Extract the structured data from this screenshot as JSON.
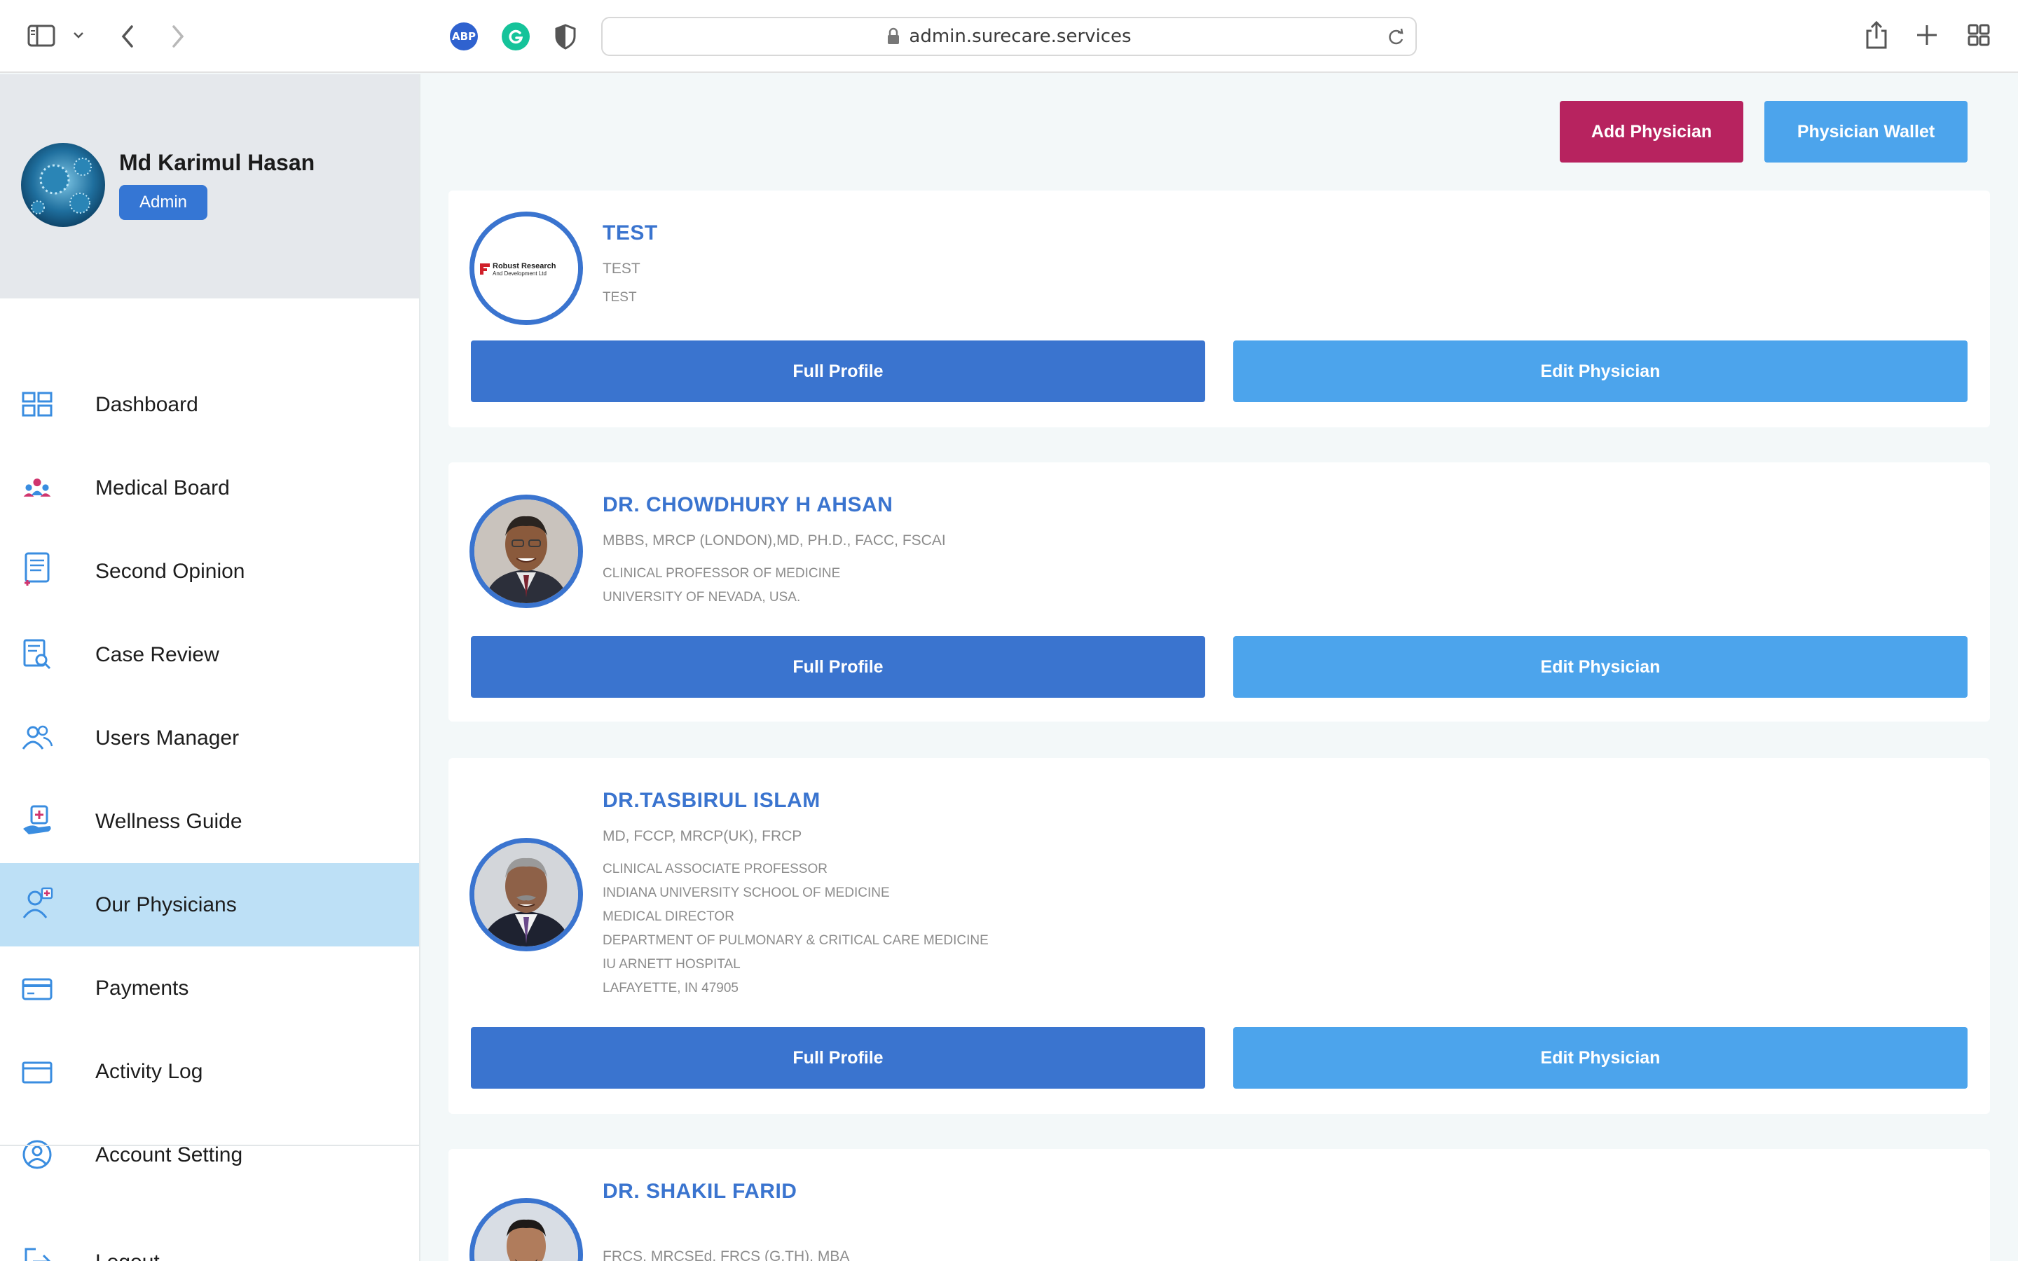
{
  "browser": {
    "url": "admin.surecare.services",
    "extensions": {
      "abp": "ABP"
    }
  },
  "user": {
    "name": "Md Karimul Hasan",
    "role": "Admin"
  },
  "nav": [
    {
      "label": "Dashboard",
      "icon": "dashboard-icon"
    },
    {
      "label": "Medical Board",
      "icon": "medical-board-icon"
    },
    {
      "label": "Second Opinion",
      "icon": "second-opinion-icon"
    },
    {
      "label": "Case Review",
      "icon": "case-review-icon"
    },
    {
      "label": "Users Manager",
      "icon": "users-icon"
    },
    {
      "label": "Wellness Guide",
      "icon": "wellness-icon"
    },
    {
      "label": "Our Physicians",
      "icon": "physicians-icon",
      "active": true
    },
    {
      "label": "Payments",
      "icon": "payments-icon"
    },
    {
      "label": "Activity Log",
      "icon": "activity-log-icon"
    },
    {
      "label": "Account Setting",
      "icon": "account-icon"
    },
    {
      "label": "Logout",
      "icon": "logout-icon"
    }
  ],
  "actions": {
    "add": "Add Physician",
    "wallet": "Physician Wallet"
  },
  "buttons": {
    "full": "Full Profile",
    "edit": "Edit Physician"
  },
  "physicians": [
    {
      "name": "TEST",
      "degree": "TEST",
      "lines": [
        "TEST"
      ],
      "logo_text": [
        "Robust Research",
        "And Development Ltd"
      ]
    },
    {
      "name": "DR. CHOWDHURY H AHSAN",
      "degree": "MBBS, MRCP (LONDON),MD, PH.D., FACC, FSCAI",
      "lines": [
        "CLINICAL PROFESSOR OF MEDICINE",
        "UNIVERSITY OF NEVADA, USA."
      ]
    },
    {
      "name": "DR.TASBIRUL ISLAM",
      "degree": "MD, FCCP, MRCP(UK), FRCP",
      "lines": [
        "CLINICAL ASSOCIATE PROFESSOR",
        "INDIANA UNIVERSITY SCHOOL OF MEDICINE",
        "MEDICAL DIRECTOR",
        "DEPARTMENT OF PULMONARY & CRITICAL CARE MEDICINE",
        "IU ARNETT HOSPITAL",
        "LAFAYETTE, IN 47905"
      ]
    },
    {
      "name": "DR. SHAKIL FARID",
      "degree": "FRCS, MRCSEd, FRCS (G.TH), MBA",
      "lines": []
    }
  ],
  "colors": {
    "primary": "#3a74cf",
    "light": "#4ca4ec",
    "accent": "#b7235f",
    "active_nav": "#bde0f6"
  }
}
